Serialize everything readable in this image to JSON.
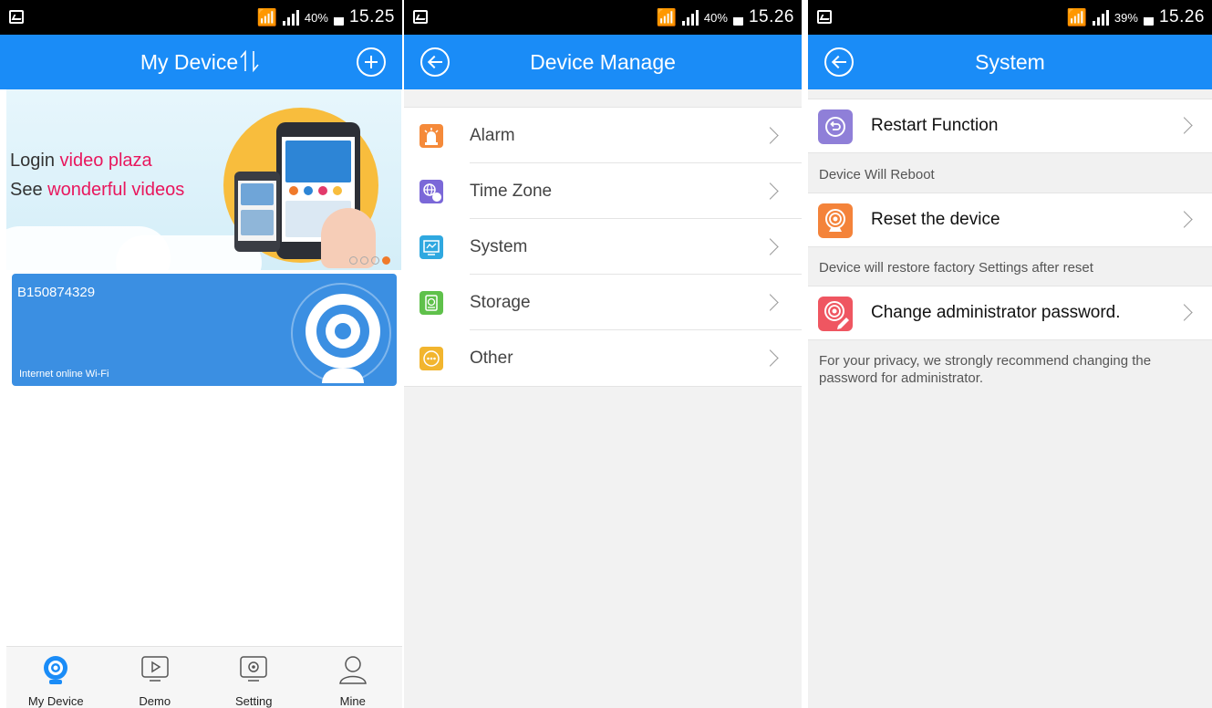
{
  "screens": [
    {
      "status": {
        "battery": "40%",
        "time": "15.25"
      },
      "header": {
        "title": "My Device"
      },
      "banner": {
        "line1_prefix": "Login ",
        "line1_highlight": "video plaza",
        "line2_prefix": "See ",
        "line2_highlight": "wonderful videos"
      },
      "device": {
        "id": "B150874329",
        "status": "Internet online Wi-Fi"
      },
      "tabs": [
        {
          "label": "My Device",
          "icon": "camera-icon",
          "color": "#1a8cf7"
        },
        {
          "label": "Demo",
          "icon": "play-icon"
        },
        {
          "label": "Setting",
          "icon": "settings-icon"
        },
        {
          "label": "Mine",
          "icon": "user-icon"
        }
      ]
    },
    {
      "status": {
        "battery": "40%",
        "time": "15.26"
      },
      "header": {
        "title": "Device Manage"
      },
      "items": [
        {
          "label": "Alarm",
          "icon": "alarm-icon",
          "color": "#f58a3a"
        },
        {
          "label": "Time Zone",
          "icon": "globe-clock-icon",
          "color": "#7b68d8"
        },
        {
          "label": "System",
          "icon": "monitor-icon",
          "color": "#2fa8e0"
        },
        {
          "label": "Storage",
          "icon": "storage-icon",
          "color": "#5fc14b"
        },
        {
          "label": "Other",
          "icon": "more-icon",
          "color": "#f2b52e"
        }
      ]
    },
    {
      "status": {
        "battery": "39%",
        "time": "15.26"
      },
      "header": {
        "title": "System"
      },
      "items": [
        {
          "label": "Restart Function",
          "note": "Device Will Reboot",
          "icon": "restart-icon",
          "color": "#8f7fd8"
        },
        {
          "label": "Reset the device",
          "note": "Device will restore factory Settings after reset",
          "icon": "reset-icon",
          "color": "#f4833a"
        },
        {
          "label": "Change administrator password.",
          "note": "For your privacy, we strongly recommend changing the password for administrator.",
          "icon": "password-icon",
          "color": "#ef5661"
        }
      ]
    }
  ]
}
